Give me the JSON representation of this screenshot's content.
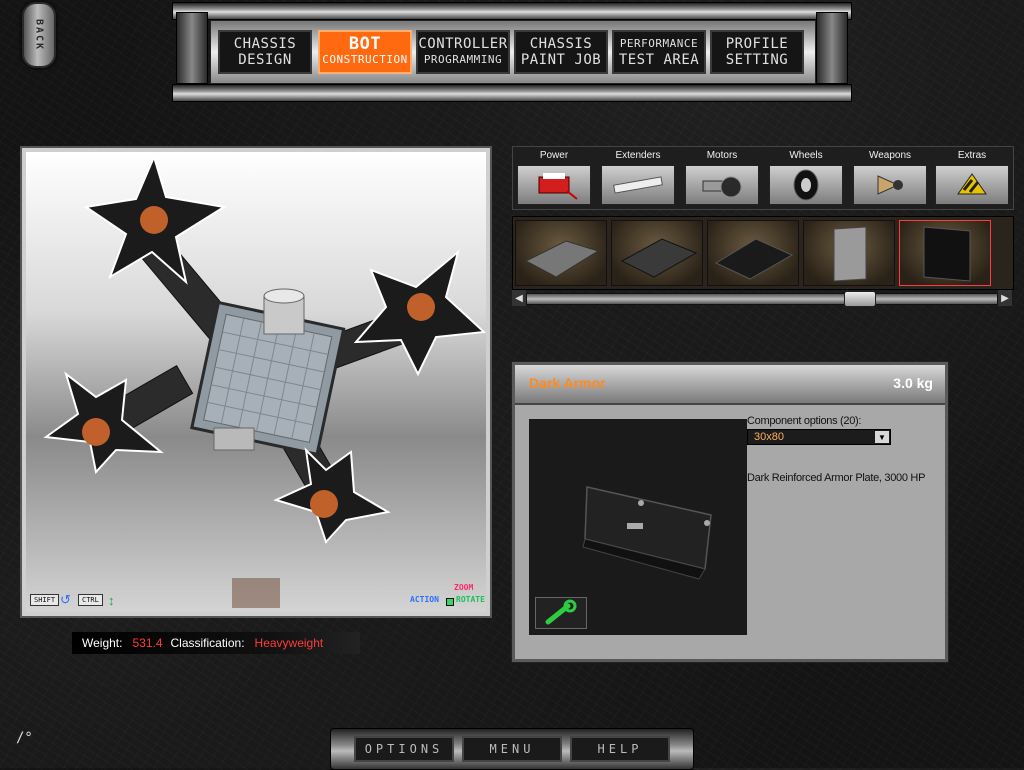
{
  "back_label": "BACK",
  "nav": {
    "tabs": [
      {
        "line1": "CHASSIS",
        "line2": "DESIGN",
        "active": false
      },
      {
        "line1": "BOT",
        "line2": "CONSTRUCTION",
        "active": true
      },
      {
        "line1": "CONTROLLER",
        "line2": "PROGRAMMING",
        "active": false
      },
      {
        "line1": "CHASSIS",
        "line2": "PAINT JOB",
        "active": false
      },
      {
        "line1": "PERFORMANCE",
        "line2": "TEST AREA",
        "active": false
      },
      {
        "line1": "PROFILE",
        "line2": "SETTING",
        "active": false
      }
    ]
  },
  "viewport": {
    "keys": {
      "shift": "SHIFT",
      "ctrl": "CTRL"
    },
    "legend": {
      "zoom": "ZOOM",
      "action": "ACTION",
      "rotate": "ROTATE"
    }
  },
  "stats": {
    "weight_label": "Weight:",
    "weight_value": "531.4",
    "class_label": "Classification:",
    "class_value": "Heavyweight"
  },
  "categories": [
    {
      "name": "Power",
      "icon": "power-icon"
    },
    {
      "name": "Extenders",
      "icon": "extender-icon"
    },
    {
      "name": "Motors",
      "icon": "motor-icon"
    },
    {
      "name": "Wheels",
      "icon": "wheel-icon"
    },
    {
      "name": "Weapons",
      "icon": "weapon-icon"
    },
    {
      "name": "Extras",
      "icon": "extras-icon"
    }
  ],
  "parts_strip": {
    "items": [
      "armor-plate-1",
      "armor-plate-2",
      "armor-plate-3",
      "armor-plate-4",
      "armor-plate-5"
    ],
    "scroll_position": 0.66
  },
  "detail": {
    "title": "Dark Armor",
    "weight": "3.0 kg",
    "options_label": "Component options (20):",
    "selected_option": "30x80",
    "description": "Dark Reinforced Armor Plate, 3000 HP"
  },
  "bottom_menu": {
    "options": "OPTIONS",
    "menu": "MENU",
    "help": "HELP"
  },
  "fps_text": "/°",
  "colors": {
    "accent": "#ff6a10",
    "stat_red": "#ff3b3b",
    "title_orange": "#ff8a20"
  }
}
